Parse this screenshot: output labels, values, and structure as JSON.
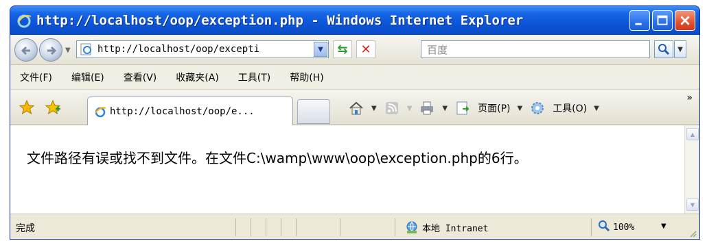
{
  "window": {
    "title": "http://localhost/oop/exception.php - Windows Internet Explorer"
  },
  "address_bar": {
    "url": "http://localhost/oop/excepti",
    "search_placeholder": "百度"
  },
  "menu": {
    "items": [
      "文件(F)",
      "编辑(E)",
      "查看(V)",
      "收藏夹(A)",
      "工具(T)",
      "帮助(H)"
    ]
  },
  "tab": {
    "title": "http://localhost/oop/e..."
  },
  "command_bar": {
    "page_label": "页面(P)",
    "tools_label": "工具(O)",
    "more": "»"
  },
  "content": {
    "message": "文件路径有误或找不到文件。在文件C:\\wamp\\www\\oop\\exception.php的6行。"
  },
  "status": {
    "text": "完成",
    "zone": "本地 Intranet",
    "zoom": "100%"
  },
  "colors": {
    "titlebar": "#0c55d8",
    "frame": "#ece9d8",
    "close_button": "#e2522f"
  },
  "icons": {
    "title": "ie-logo-icon",
    "back": "back-arrow-icon",
    "forward": "forward-arrow-icon",
    "refresh": "refresh-icon",
    "stop": "stop-icon",
    "search": "search-icon",
    "favorites": "favorites-star-icon",
    "add_favorites": "add-favorites-icon",
    "home": "home-icon",
    "feeds": "rss-feed-icon",
    "print": "print-icon",
    "page": "page-icon",
    "tools": "gear-icon",
    "zone": "intranet-globe-icon",
    "zoom": "zoom-icon"
  }
}
